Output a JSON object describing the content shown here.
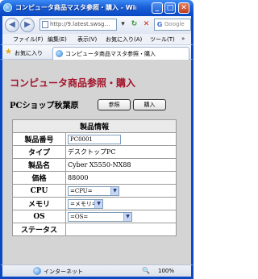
{
  "window": {
    "title": "コンピュータ商品マスタ参照・購入 - Windows Internet Explorer"
  },
  "toolbar": {
    "address": "http://9.latest.swsg…",
    "search_placeholder": "Google"
  },
  "menu": [
    "ファイル(F)",
    "編集(E)",
    "表示(V)",
    "お気に入り(A)",
    "ツール(T)"
  ],
  "favorites_label": "お気に入り",
  "tab": {
    "title": "コンピュータ商品マスタ参照・購入"
  },
  "page": {
    "heading": "コンピュータ商品参照・購入",
    "shop_name": "PCショップ秋葉原",
    "buttons": {
      "reference": "参照",
      "purchase": "購入"
    }
  },
  "product": {
    "caption": "製品情報",
    "labels": {
      "id": "製品番号",
      "type": "タイプ",
      "name": "製品名",
      "price": "価格",
      "cpu": "CPU",
      "memory": "メモリ",
      "os": "OS",
      "status": "ステータス"
    },
    "values": {
      "id": "PC0001",
      "type": "デスクトップPC",
      "name": "Cyber X5550-NX88",
      "price": "88000",
      "cpu": "=CPU=",
      "memory": "=メモリ=",
      "os": "=OS=",
      "status": ""
    }
  },
  "statusbar": {
    "zone": "インターネット",
    "zoom": "100%"
  }
}
